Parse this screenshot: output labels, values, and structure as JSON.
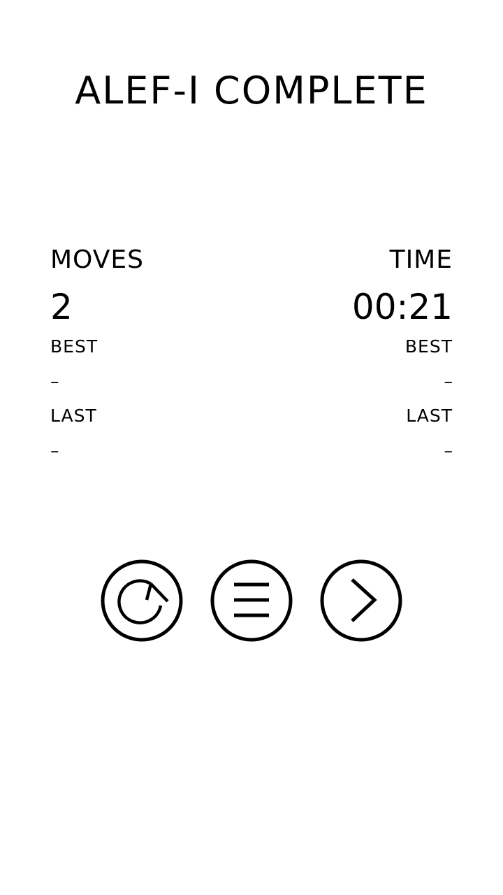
{
  "title": "ALEF-I COMPLETE",
  "moves": {
    "label": "MOVES",
    "value": "2",
    "best_label": "BEST",
    "best_value": "–",
    "last_label": "LAST",
    "last_value": "–"
  },
  "time": {
    "label": "TIME",
    "value": "00:21",
    "best_label": "BEST",
    "best_value": "–",
    "last_label": "LAST",
    "last_value": "–"
  },
  "buttons": {
    "restart_icon": "restart-icon",
    "menu_icon": "menu-icon",
    "next_icon": "chevron-right-icon"
  },
  "colors": {
    "background": "#ffffff",
    "foreground": "#000000"
  }
}
